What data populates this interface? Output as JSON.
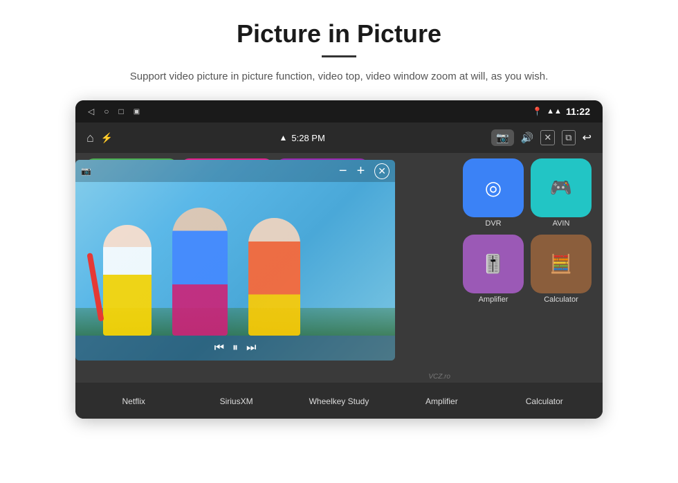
{
  "header": {
    "title": "Picture in Picture",
    "subtitle": "Support video picture in picture function, video top, video window zoom at will, as you wish."
  },
  "statusBar": {
    "time": "11:22",
    "appBarTime": "5:28 PM"
  },
  "pipControls": {
    "minus": "−",
    "plus": "+",
    "close": "✕",
    "camera_indicator": "📷"
  },
  "apps": {
    "dvr_label": "DVR",
    "avin_label": "AVIN",
    "amplifier_label": "Amplifier",
    "calculator_label": "Calculator",
    "netflix_label": "Netflix",
    "siriusxm_label": "SiriusXM",
    "wheelkey_label": "Wheelkey Study"
  },
  "bottomLabels": [
    "Netflix",
    "SiriusXM",
    "Wheelkey Study",
    "Amplifier",
    "Calculator"
  ],
  "watermark": "VCZ.ro"
}
